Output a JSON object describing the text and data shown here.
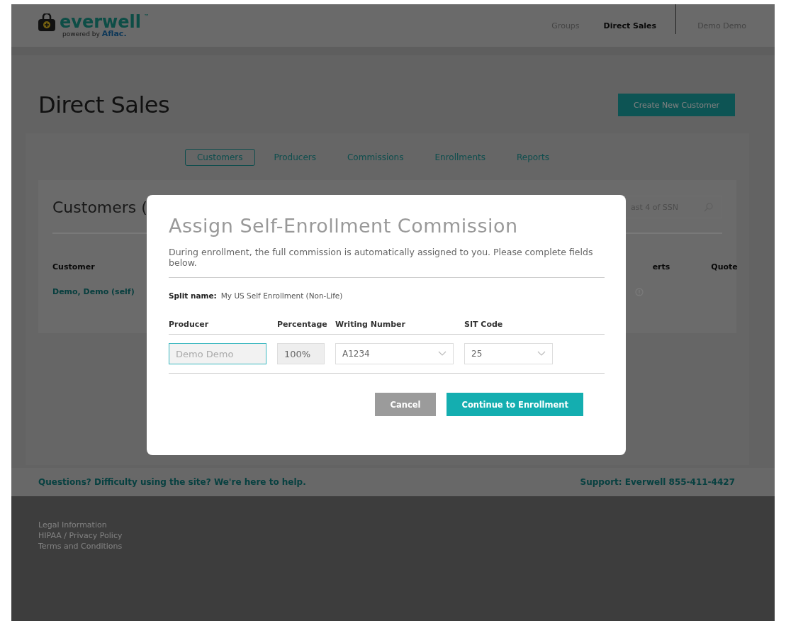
{
  "header": {
    "logo": {
      "name": "everwell",
      "trademark": "™",
      "powered_by": "powered by",
      "partner": "Aflac."
    },
    "nav": [
      {
        "label": "Groups",
        "selected": false
      },
      {
        "label": "Direct Sales",
        "selected": true
      }
    ],
    "user": "Demo Demo"
  },
  "page": {
    "title": "Direct Sales",
    "create_button": "Create New Customer",
    "tabs": [
      {
        "label": "Customers",
        "selected": true
      },
      {
        "label": "Producers",
        "selected": false
      },
      {
        "label": "Commissions",
        "selected": false
      },
      {
        "label": "Enrollments",
        "selected": false
      },
      {
        "label": "Reports",
        "selected": false
      }
    ],
    "card": {
      "title": "Customers (",
      "search": {
        "placeholder": "ast 4 of SSN"
      },
      "columns": [
        "Customer",
        "erts",
        "Quote"
      ],
      "rows": [
        {
          "customer": "Demo, Demo (self)"
        }
      ]
    }
  },
  "modal": {
    "title": "Assign Self-Enrollment Commission",
    "description": "During enrollment, the full commission is automatically assigned to you. Please complete fields below.",
    "split_label": "Split name:",
    "split_value": "My US Self Enrollment (Non-Life)",
    "columns": [
      "Producer",
      "Percentage",
      "Writing Number",
      "SIT Code"
    ],
    "fields": [
      {
        "kind": "text",
        "placeholder": "Demo Demo",
        "focused": true
      },
      {
        "kind": "readonly",
        "value": "100%"
      },
      {
        "kind": "select",
        "value": "A1234"
      },
      {
        "kind": "select",
        "value": "25"
      }
    ],
    "buttons": [
      {
        "kind": "secondary",
        "label": "Cancel"
      },
      {
        "kind": "primary",
        "label": "Continue to Enrollment"
      }
    ]
  },
  "footer": {
    "help": "Questions? Difficulty using the site? We're here to help.",
    "support": "Support: Everwell 855-411-4427",
    "links": [
      "Legal Information",
      "HIPAA / Privacy Policy",
      "Terms and Conditions"
    ]
  }
}
